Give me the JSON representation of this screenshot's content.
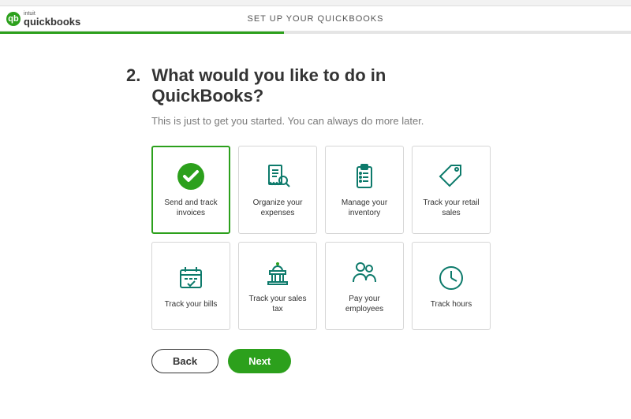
{
  "brand": {
    "intuit": "intuit",
    "product": "quickbooks",
    "badge": "qb"
  },
  "header": {
    "title": "SET UP YOUR QUICKBOOKS"
  },
  "progress": {
    "percent": 45
  },
  "step": {
    "number": "2.",
    "title": "What would you like to do in QuickBooks?",
    "subtitle": "This is just to get you started. You can always do more later."
  },
  "cards": [
    {
      "label": "Send and track invoices",
      "selected": true
    },
    {
      "label": "Organize your expenses",
      "selected": false
    },
    {
      "label": "Manage your inventory",
      "selected": false
    },
    {
      "label": "Track your retail sales",
      "selected": false
    },
    {
      "label": "Track your bills",
      "selected": false
    },
    {
      "label": "Track your sales tax",
      "selected": false
    },
    {
      "label": "Pay your employees",
      "selected": false
    },
    {
      "label": "Track hours",
      "selected": false
    }
  ],
  "buttons": {
    "back": "Back",
    "next": "Next"
  },
  "colors": {
    "primary": "#2ca01c",
    "accent_dark": "#0d7a6b",
    "muted": "#7a7a7a"
  }
}
